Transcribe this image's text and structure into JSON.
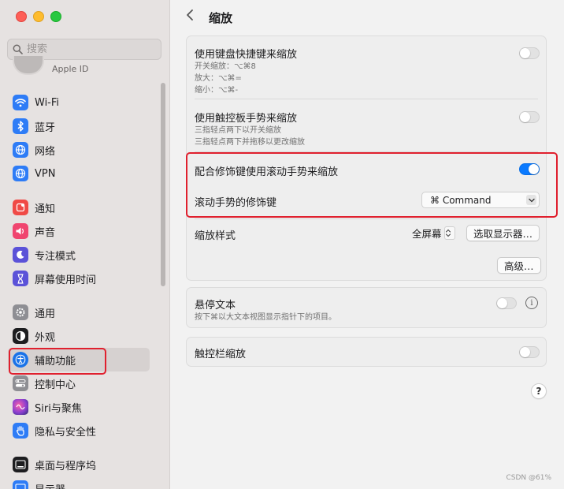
{
  "sidebar": {
    "search_placeholder": "搜索",
    "apple_id_label": "Apple ID",
    "items": [
      {
        "label": "Wi-Fi",
        "icon": "wifi-icon",
        "color": "#2e7cf6"
      },
      {
        "label": "蓝牙",
        "icon": "bluetooth-icon",
        "color": "#2e7cf6"
      },
      {
        "label": "网络",
        "icon": "globe-icon",
        "color": "#2e7cf6"
      },
      {
        "label": "VPN",
        "icon": "vpn-globe-icon",
        "color": "#2e7cf6"
      },
      {
        "label": "通知",
        "icon": "notification-bell-icon",
        "color": "#f04a46"
      },
      {
        "label": "声音",
        "icon": "speaker-icon",
        "color": "#f0456f"
      },
      {
        "label": "专注模式",
        "icon": "moon-icon",
        "color": "#5b52d8"
      },
      {
        "label": "屏幕使用时间",
        "icon": "hourglass-icon",
        "color": "#5b52d8"
      },
      {
        "label": "通用",
        "icon": "gear-icon",
        "color": "#8e8e93"
      },
      {
        "label": "外观",
        "icon": "appearance-icon",
        "color": "#1d1d1f"
      },
      {
        "label": "辅助功能",
        "icon": "accessibility-icon",
        "color": "#1a73e8"
      },
      {
        "label": "控制中心",
        "icon": "control-center-icon",
        "color": "#8e8e93"
      },
      {
        "label": "Siri与聚焦",
        "icon": "siri-icon",
        "color": "#8a3fd1"
      },
      {
        "label": "隐私与安全性",
        "icon": "hand-icon",
        "color": "#2e7cf6"
      },
      {
        "label": "桌面与程序坞",
        "icon": "dock-icon",
        "color": "#1d1d1f"
      },
      {
        "label": "显示器",
        "icon": "display-icon",
        "color": "#2e7cf6"
      }
    ]
  },
  "header": {
    "title": "缩放"
  },
  "zoom": {
    "keyboard": {
      "title": "使用键盘快捷键来缩放",
      "sub1": "开关缩放：⌥⌘8",
      "sub2": "放大：⌥⌘=",
      "sub3": "缩小：⌥⌘-",
      "enabled": false
    },
    "trackpad": {
      "title": "使用触控板手势来缩放",
      "sub1": "三指轻点两下以开关缩放",
      "sub2": "三指轻点两下并拖移以更改缩放",
      "enabled": false
    },
    "scroll": {
      "title": "配合修饰键使用滚动手势来缩放",
      "enabled": true
    },
    "modifier": {
      "label": "滚动手势的修饰键",
      "value": "⌘ Command"
    },
    "style": {
      "label": "缩放样式",
      "value": "全屏幕",
      "select_display_button": "选取显示器…"
    },
    "advanced_button": "高级…"
  },
  "hover_text": {
    "title": "悬停文本",
    "sub": "按下⌘以大文本视图显示指针下的项目。",
    "enabled": false
  },
  "touchbar_zoom": {
    "title": "触控栏缩放",
    "enabled": false
  },
  "help_label": "?",
  "watermark": "CSDN @61%",
  "colors": {
    "accent": "#0a7aff",
    "highlight_box": "#e0202e"
  }
}
